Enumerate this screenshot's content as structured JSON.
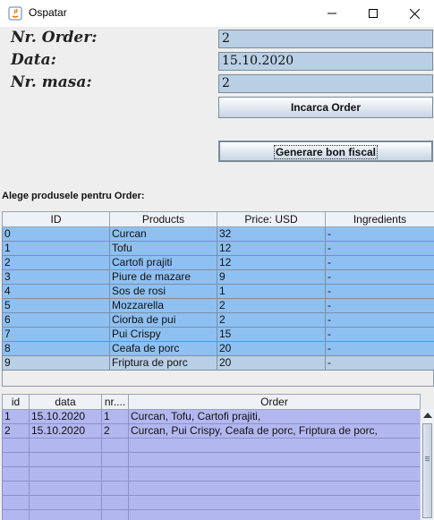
{
  "window": {
    "title": "Ospatar"
  },
  "form": {
    "order_label": "Nr. Order:",
    "order_value": "2",
    "date_label": "Data:",
    "date_value": "15.10.2020",
    "table_label": "Nr. masa:",
    "table_value": "2",
    "load_button": "Incarca Order",
    "receipt_button": "Generare bon fiscal"
  },
  "products_section_label": "Alege produsele pentru Order:",
  "products": {
    "columns": [
      "ID",
      "Products",
      "Price: USD",
      "Ingredients"
    ],
    "rows": [
      [
        "0",
        "Curcan",
        "32",
        "-"
      ],
      [
        "1",
        "Tofu",
        "12",
        "-"
      ],
      [
        "2",
        "Cartofi prajiti",
        "12",
        "-"
      ],
      [
        "3",
        "Piure de mazare",
        "9",
        "-"
      ],
      [
        "4",
        "Sos de rosi",
        "1",
        "-"
      ],
      [
        "5",
        "Mozzarella",
        "2",
        "-"
      ],
      [
        "6",
        "Ciorba de pui",
        "2",
        "-"
      ],
      [
        "7",
        "Pui Crispy",
        "15",
        "-"
      ],
      [
        "8",
        "Ceafa de porc",
        "20",
        "-"
      ],
      [
        "9",
        "Friptura de porc",
        "20",
        "-"
      ]
    ],
    "selected_row": 9
  },
  "orders": {
    "columns": [
      "id",
      "data",
      "nr....",
      "Order"
    ],
    "rows": [
      [
        "1",
        "15.10.2020",
        "1",
        "Curcan, Tofu, Cartofi prajiti,"
      ],
      [
        "2",
        "15.10.2020",
        "2",
        "Curcan, Pui Crispy, Ceafa de porc, Friptura de porc,"
      ]
    ]
  },
  "colors": {
    "field_bg": "#b8cfe5",
    "products_row": "#8ec0f2",
    "products_selected": "#b8cfe5",
    "orders_row": "#b3b7f0"
  },
  "icons": [
    "java-app-icon",
    "minimize-icon",
    "maximize-icon",
    "close-icon",
    "scroll-up-arrow-icon"
  ]
}
